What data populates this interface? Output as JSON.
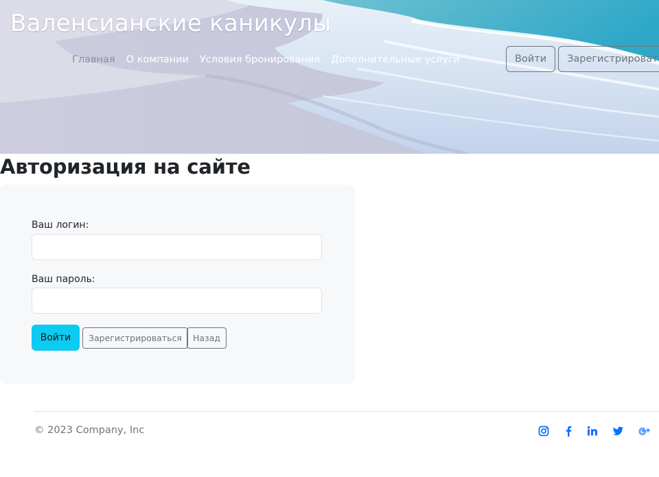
{
  "header": {
    "site_title": "Валенсианские каникулы",
    "nav": {
      "home": "Главная",
      "about": "О компании",
      "booking_terms": "Условия бронирования",
      "extra_services": "Дополнительные услуги"
    },
    "login_label": "Войти",
    "register_label": "Зарегистрироваться",
    "background_image": "beach-waves"
  },
  "login": {
    "heading": "Авторизация на сайте",
    "login_label": "Ваш логин:",
    "login_value": "",
    "password_label": "Ваш пароль:",
    "password_value": "",
    "submit_label": "Войти",
    "register_label": "Зарегистрироваться",
    "back_label": "Назад"
  },
  "footer": {
    "copyright": "© 2023 Company, Inc",
    "social_icons": [
      "instagram-icon",
      "facebook-icon",
      "linkedin-icon",
      "twitter-icon",
      "google-plus-icon"
    ]
  },
  "colors": {
    "accent": "#0dcaf0",
    "secondary": "#6c757d",
    "social": "#0d6efd",
    "card_bg": "#f7f8f9"
  }
}
